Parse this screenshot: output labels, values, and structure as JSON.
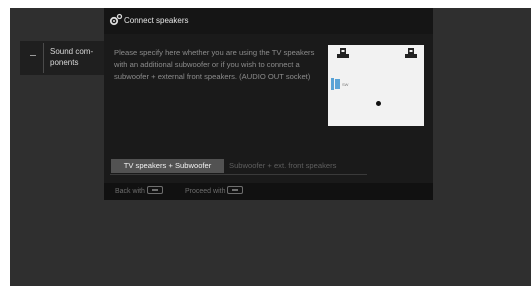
{
  "menu": {
    "item_label": "Sound com-\nponents"
  },
  "dialog": {
    "title": "Connect speakers",
    "description": "Please specify here whether you are using the TV speakers with an additional subwoofer or if you wish to connect a subwoofer + external front speakers. (AUDIO OUT socket)",
    "diagram": {
      "subwoofer_label": "SW"
    },
    "options": [
      {
        "label": "TV speakers + Subwoofer",
        "selected": true
      },
      {
        "label": "Subwoofer + ext. front speakers",
        "selected": false
      }
    ],
    "footer": {
      "back_label": "Back with",
      "proceed_label": "Proceed with"
    }
  }
}
